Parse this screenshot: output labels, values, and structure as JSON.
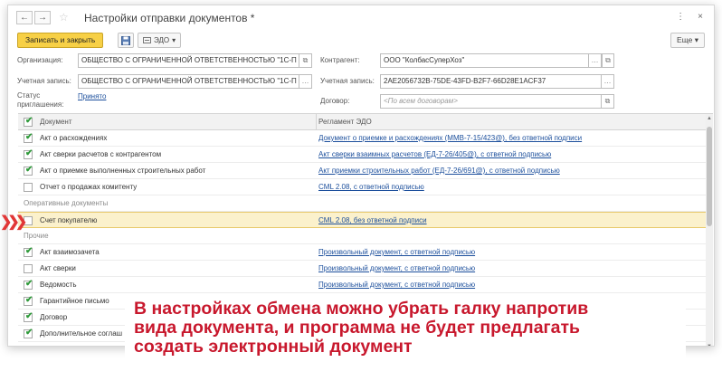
{
  "window": {
    "title": "Настройки отправки документов *",
    "nav": {
      "back": "←",
      "forward": "→"
    },
    "controls": {
      "menu": "⋮",
      "close": "×"
    }
  },
  "toolbar": {
    "save_close_label": "Записать и закрыть",
    "edo_label": "ЭДО",
    "more_label": "Еще"
  },
  "form": {
    "organization_label": "Организация:",
    "organization_value": "ОБЩЕСТВО С ОГРАНИЧЕННОЙ ОТВЕТСТВЕННОСТЬЮ \"1С-П",
    "account_label": "Учетная запись:",
    "account_value": "ОБЩЕСТВО С ОГРАНИЧЕННОЙ ОТВЕТСТВЕННОСТЬЮ \"1С-П",
    "status_label": "Статус приглашения:",
    "status_value": "Принято",
    "counterparty_label": "Контрагент:",
    "counterparty_value": "ООО \"КолбасСуперХоз\"",
    "cp_account_label": "Учетная запись:",
    "cp_account_value": "2AE2056732B-75DE-43FD-B2F7-66D28E1ACF37",
    "contract_label": "Договор:",
    "contract_placeholder": "<По всем договорам>"
  },
  "table": {
    "columns": {
      "doc": "Документ",
      "reg": "Регламент ЭДО"
    },
    "rows": [
      {
        "type": "item",
        "checked": true,
        "doc": "Акт о расхождениях",
        "reg": "Документ о приемке и расхождениях (ММВ-7-15/423@), без ответной подписи"
      },
      {
        "type": "item",
        "checked": true,
        "doc": "Акт сверки расчетов с контрагентом",
        "reg": "Акт сверки взаимных расчетов (ЕД-7-26/405@), с ответной подписью"
      },
      {
        "type": "item",
        "checked": true,
        "doc": "Акт о приемке выполненных строительных работ",
        "reg": "Акт приемки строительных работ (ЕД-7-26/691@), с ответной подписью"
      },
      {
        "type": "item",
        "checked": false,
        "doc": "Отчет о продажах комитенту",
        "reg": "CML 2.08, с ответной подписью"
      },
      {
        "type": "group",
        "doc": "Оперативные документы"
      },
      {
        "type": "item",
        "checked": false,
        "selected": true,
        "doc": "Счет покупателю",
        "reg": "CML 2.08, без ответной подписи"
      },
      {
        "type": "group",
        "doc": "Прочие"
      },
      {
        "type": "item",
        "checked": true,
        "doc": "Акт взаимозачета",
        "reg": "Произвольный документ, с ответной подписью"
      },
      {
        "type": "item",
        "checked": false,
        "doc": "Акт сверки",
        "reg": "Произвольный документ, с ответной подписью"
      },
      {
        "type": "item",
        "checked": true,
        "doc": "Ведомость",
        "reg": "Произвольный документ, с ответной подписью"
      },
      {
        "type": "item",
        "checked": true,
        "doc": "Гарантийное письмо",
        "reg": ""
      },
      {
        "type": "item",
        "checked": true,
        "doc": "Договор",
        "reg": ""
      },
      {
        "type": "item",
        "checked": true,
        "doc": "Дополнительное соглаш",
        "reg": ""
      }
    ]
  },
  "callout": {
    "text": "В настройках обмена можно убрать галку напротив\nвида документа, и программа не будет предлагать\nсоздать электронный документ"
  },
  "colors": {
    "accent": "#f7d046",
    "link": "#1c4f9c",
    "check": "#2f9a3a",
    "callout": "#c8182d",
    "selected_row": "#fbf1cc"
  }
}
